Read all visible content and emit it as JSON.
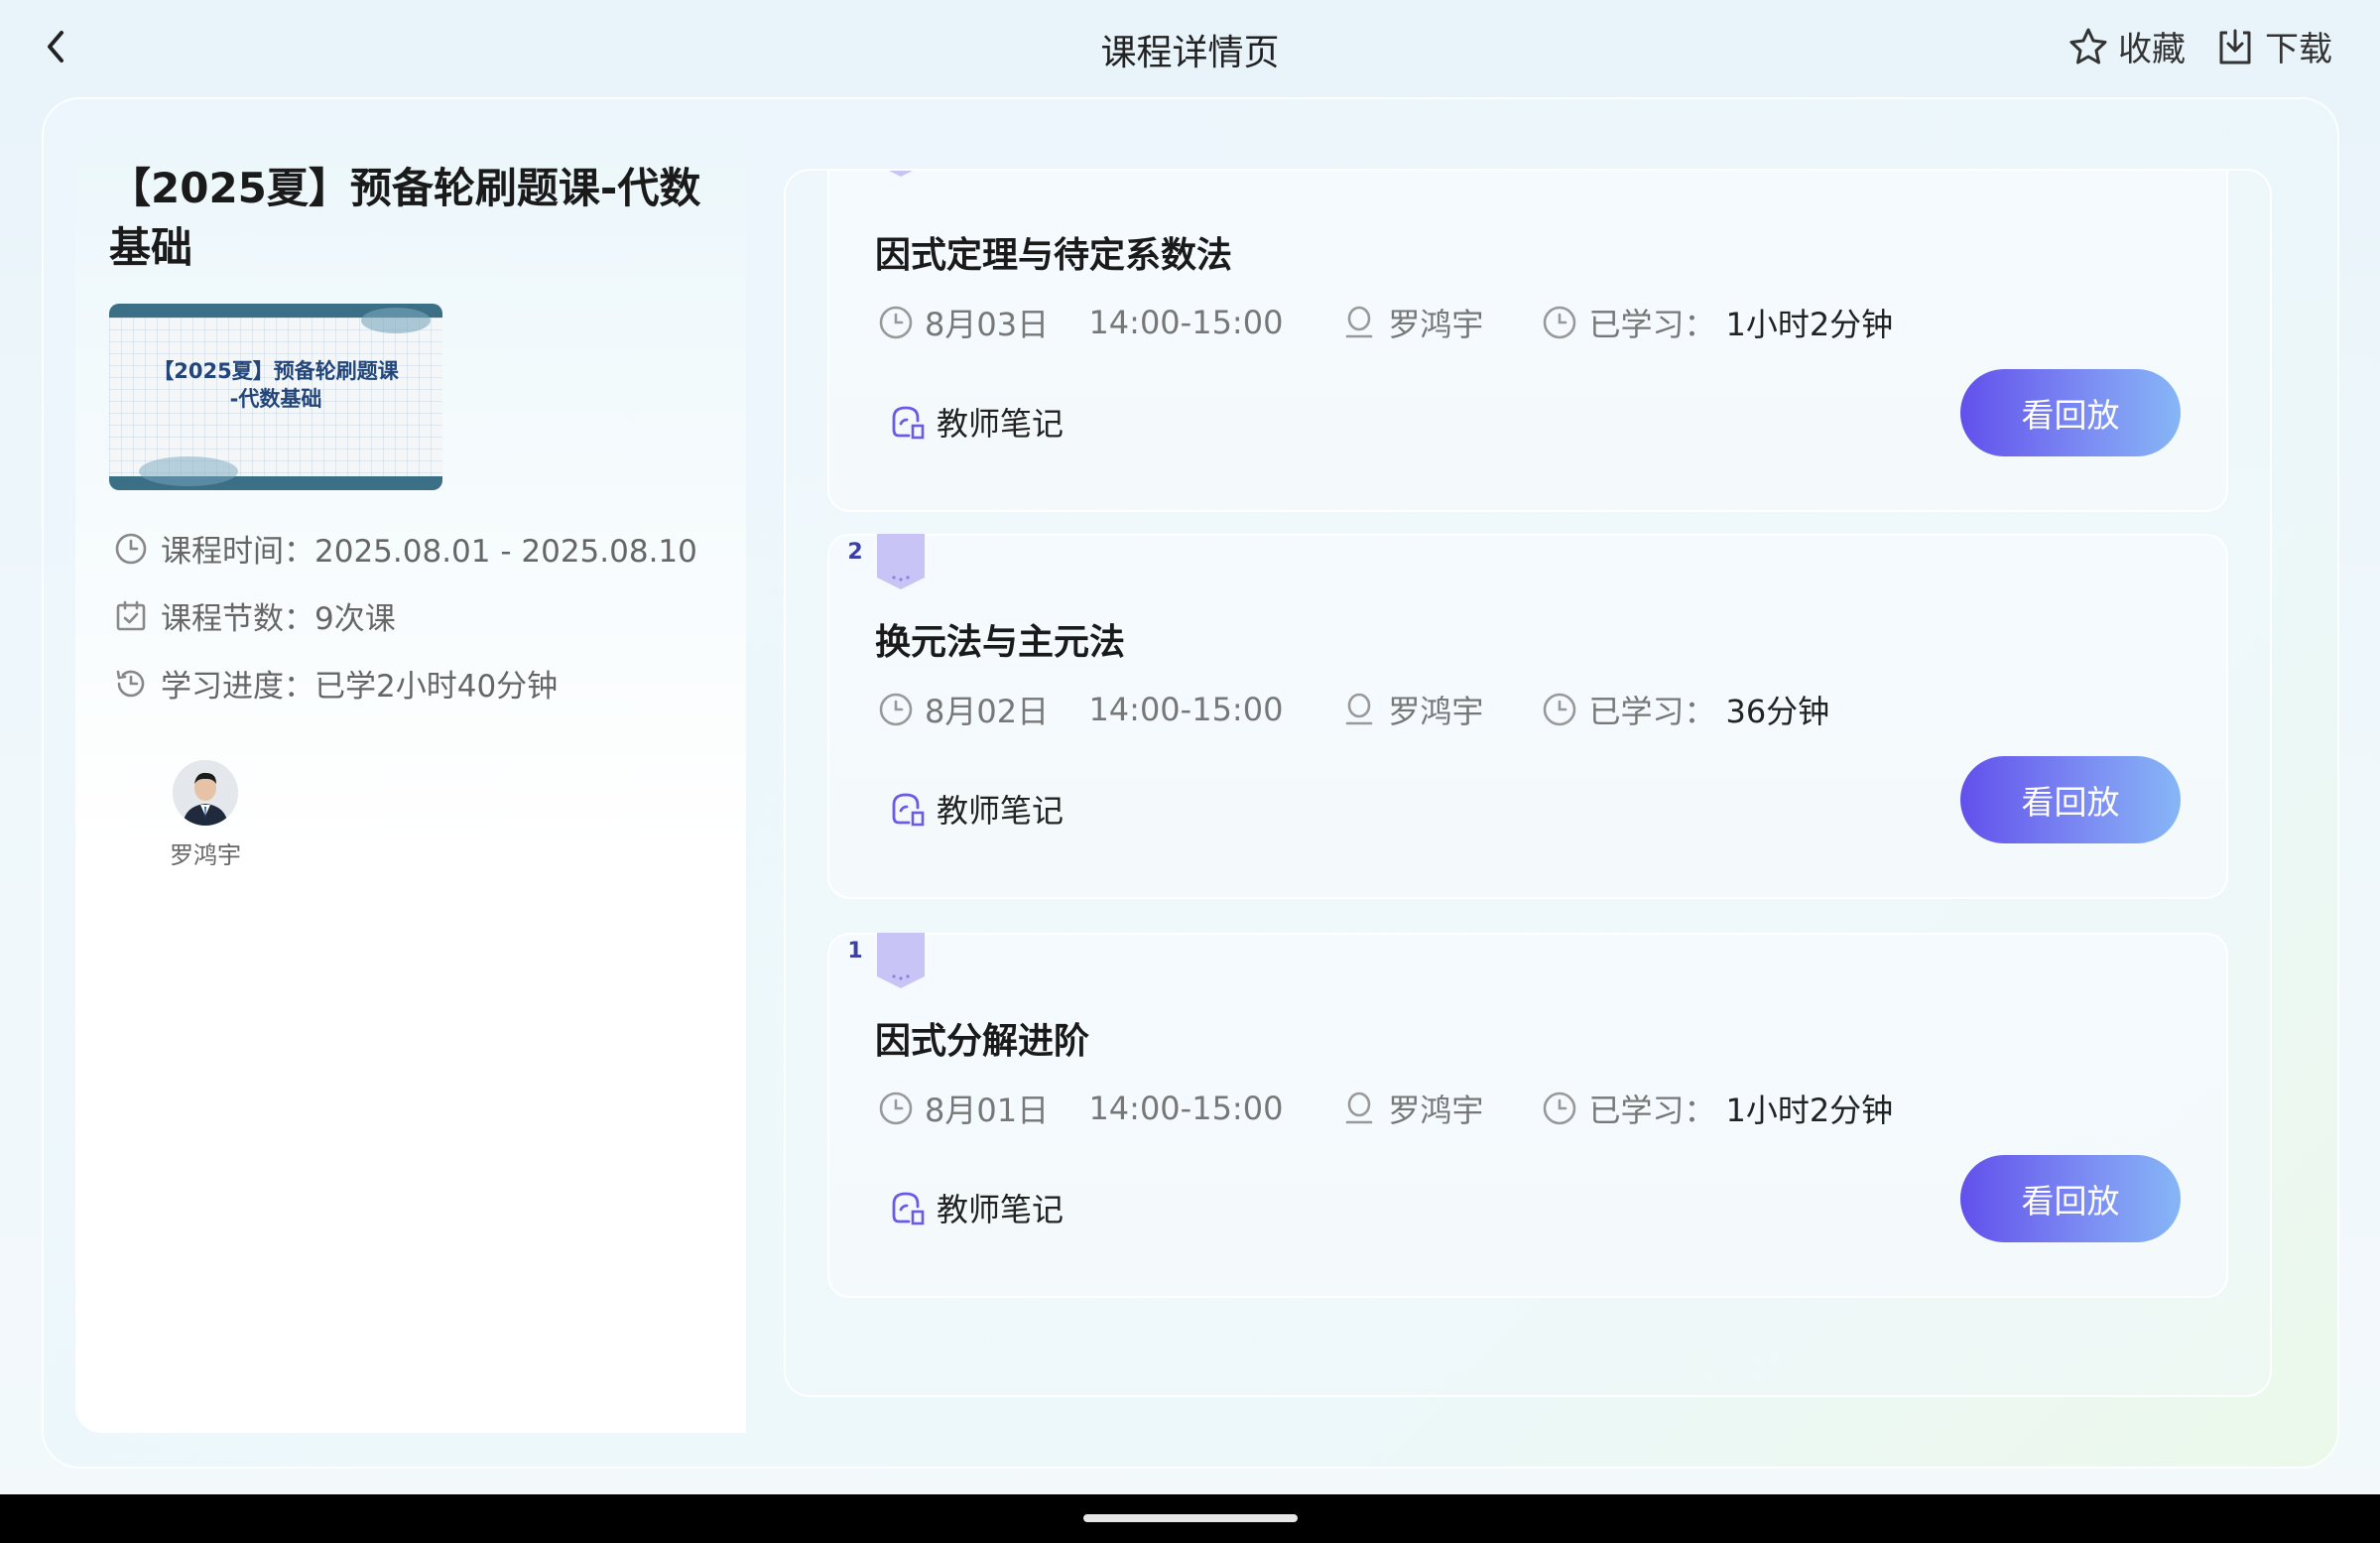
{
  "header": {
    "title": "课程详情页",
    "favorite_label": "收藏",
    "download_label": "下载"
  },
  "course": {
    "title": "【2025夏】预备轮刷题课-代数基础",
    "cover_text_line1": "【2025夏】预备轮刷题课",
    "cover_text_line2": "-代数基础",
    "time_label": "课程时间：",
    "time_value": "2025.08.01 - 2025.08.10",
    "count_label": "课程节数：",
    "count_value": "9次课",
    "progress_label": "学习进度：",
    "progress_value": "已学2小时40分钟",
    "teacher_name": "罗鸿宇"
  },
  "lessons": [
    {
      "number": "",
      "title": "因式定理与待定系数法",
      "date": "8月03日",
      "time": "14:00-15:00",
      "teacher": "罗鸿宇",
      "studied_label": "已学习：",
      "studied_value": "1小时2分钟",
      "notes_label": "教师笔记",
      "replay_label": "看回放"
    },
    {
      "number": "2",
      "title": "换元法与主元法",
      "date": "8月02日",
      "time": "14:00-15:00",
      "teacher": "罗鸿宇",
      "studied_label": "已学习：",
      "studied_value": "36分钟",
      "notes_label": "教师笔记",
      "replay_label": "看回放"
    },
    {
      "number": "1",
      "title": "因式分解进阶",
      "date": "8月01日",
      "time": "14:00-15:00",
      "teacher": "罗鸿宇",
      "studied_label": "已学习：",
      "studied_value": "1小时2分钟",
      "notes_label": "教师笔记",
      "replay_label": "看回放"
    }
  ],
  "icons": {
    "back": "chevron-left-icon",
    "favorite": "star-icon",
    "download": "download-icon",
    "clock": "clock-icon",
    "calendar": "calendar-check-icon",
    "history": "history-icon",
    "person": "person-icon",
    "notes": "notes-icon"
  },
  "colors": {
    "accent_start": "#6250ec",
    "accent_end": "#86b6f6",
    "badge": "#c9c4f6"
  }
}
